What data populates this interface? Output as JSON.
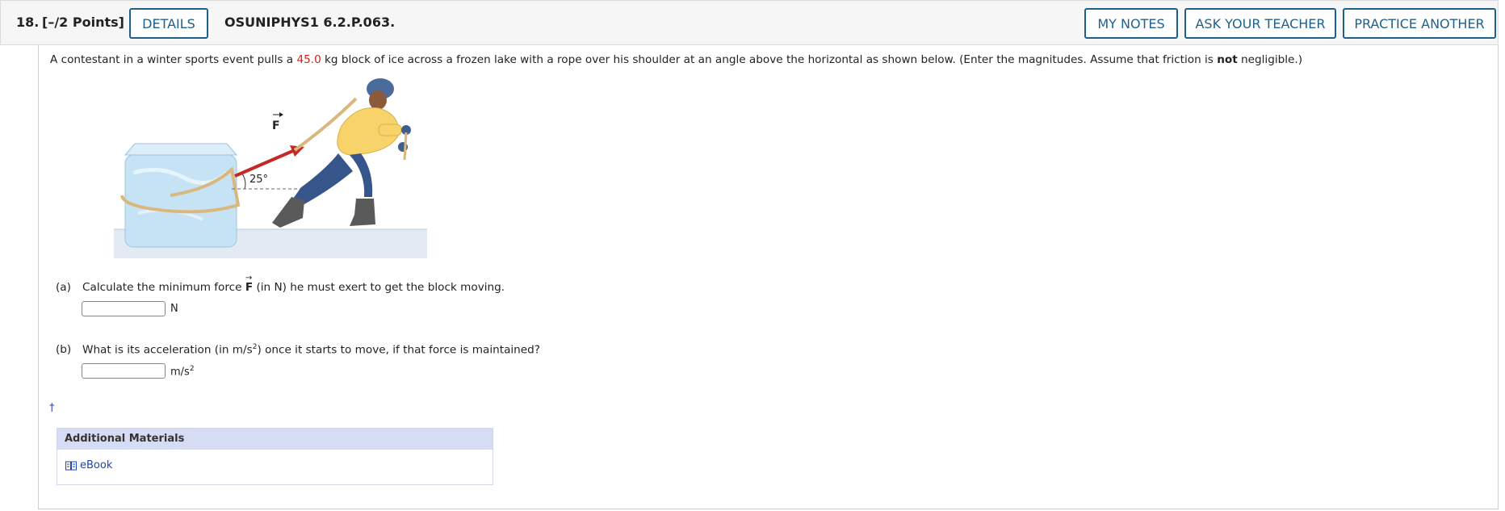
{
  "header": {
    "question_number": "18.",
    "points": "[–/2 Points]",
    "details_label": "DETAILS",
    "question_id": "OSUNIPHYS1 6.2.P.063.",
    "my_notes_label": "MY NOTES",
    "ask_teacher_label": "ASK YOUR TEACHER",
    "practice_another_label": "PRACTICE ANOTHER"
  },
  "problem": {
    "text_before_mass": "A contestant in a winter sports event pulls a ",
    "mass": "45.0",
    "text_after_mass": " kg block of ice across a frozen lake with a rope over his shoulder at an angle above the horizontal as shown below. (Enter the magnitudes. Assume that friction is ",
    "bold_word": "not",
    "text_end": " negligible.)"
  },
  "figure": {
    "force_label": "F",
    "angle_label": "25°"
  },
  "parts": {
    "a": {
      "letter": "(a)",
      "text_before": "Calculate the minimum force ",
      "force_symbol": "F",
      "text_after": " (in N) he must exert to get the block moving.",
      "input_value": "",
      "unit": "N"
    },
    "b": {
      "letter": "(b)",
      "text_before": "What is its acceleration (in m/s",
      "text_exp": "2",
      "text_after": ") once it starts to move, if that force is maintained?",
      "input_value": "",
      "unit_base": "m/s",
      "unit_exp": "2"
    }
  },
  "footnote_marker": "†",
  "materials": {
    "heading": "Additional Materials",
    "ebook_label": "eBook"
  },
  "colors": {
    "accent": "#1f5f8b",
    "highlight_red": "#d1241d",
    "materials_header": "#d5dcf4",
    "link_blue": "#1f44b3"
  }
}
